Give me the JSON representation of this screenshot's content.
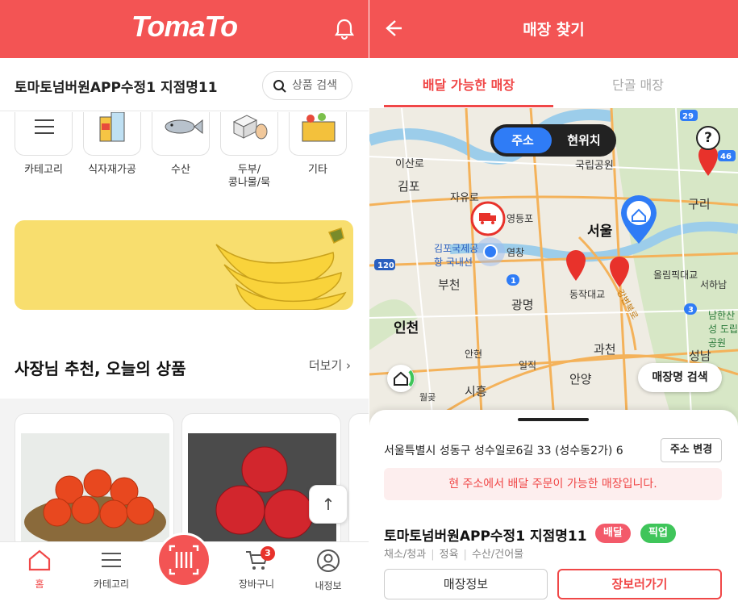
{
  "left": {
    "logo": "TomaTo",
    "store_name": "토마토넘버원APP수정1 지점명11",
    "search_placeholder": "상품 검색",
    "categories": [
      {
        "label": "카테고리",
        "icon": "menu-icon"
      },
      {
        "label": "식자재가공",
        "icon": "grocery-jars-icon"
      },
      {
        "label": "수산",
        "icon": "fish-icon"
      },
      {
        "label": "두부/\n콩나물/묵",
        "line1": "두부/",
        "line2": "콩나물/묵",
        "icon": "tofu-egg-icon"
      },
      {
        "label": "기타",
        "icon": "basket-icon"
      }
    ],
    "section_title": "사장님 추천, 오늘의 상품",
    "more_label": "더보기",
    "nav": [
      {
        "label": "홈",
        "icon": "home-icon"
      },
      {
        "label": "카테고리",
        "icon": "hamburger-icon"
      },
      {
        "label": "",
        "icon": "barcode-scan-icon"
      },
      {
        "label": "장바구니",
        "icon": "cart-icon",
        "badge": "3"
      },
      {
        "label": "내정보",
        "icon": "profile-icon"
      }
    ],
    "colors": {
      "brand": "#f35454",
      "banner": "#f8de6e"
    }
  },
  "right": {
    "title": "매장 찾기",
    "tabs": [
      {
        "label": "배달 가능한 매장",
        "active": true
      },
      {
        "label": "단골 매장",
        "active": false
      }
    ],
    "toggle": {
      "on": "주소",
      "off": "현위치"
    },
    "help": "?",
    "map_labels": {
      "seoul": "서울",
      "incheon": "인천",
      "gimpo": "김포",
      "guri": "구리",
      "bucheon": "부천",
      "gwangmyeong": "광명",
      "anyang": "안양",
      "gwacheon": "과천",
      "seongnam": "성남",
      "siheung": "시흥",
      "isan": "이산로",
      "gukrip": "국립공원",
      "gimpo_airport": "김포국제공항 국내선",
      "dongjak": "동작대교",
      "olympic": "올림픽대교",
      "seoha": "서하남",
      "namhan": "남한산성 도립공원",
      "ansan": "안현",
      "ilji": "일직",
      "wolgot": "월곶",
      "route120": "120",
      "route1": "1",
      "route3": "3",
      "route29": "29",
      "route46": "46",
      "yeomchang": "염창",
      "jayuro": "자유로",
      "gangbyeon": "강변북로",
      "yaang": "영등포"
    },
    "map_search_btn": "매장명 검색",
    "address": "서울특별시 성동구 성수일로6길 33 (성수동2가) 6",
    "address_change": "주소 변경",
    "notice": "현 주소에서 배달 주문이 가능한 매장입니다.",
    "store_name": "토마토넘버원APP수정1 지점명11",
    "chips": {
      "delivery": "배달",
      "pickup": "픽업"
    },
    "store_categories": [
      "채소/청과",
      "정육",
      "수산/건어물"
    ],
    "btn_info": "매장정보",
    "btn_go": "장보러가기",
    "colors": {
      "accent": "#f04747",
      "blue": "#2f7cf6",
      "green": "#3fc55a"
    }
  }
}
